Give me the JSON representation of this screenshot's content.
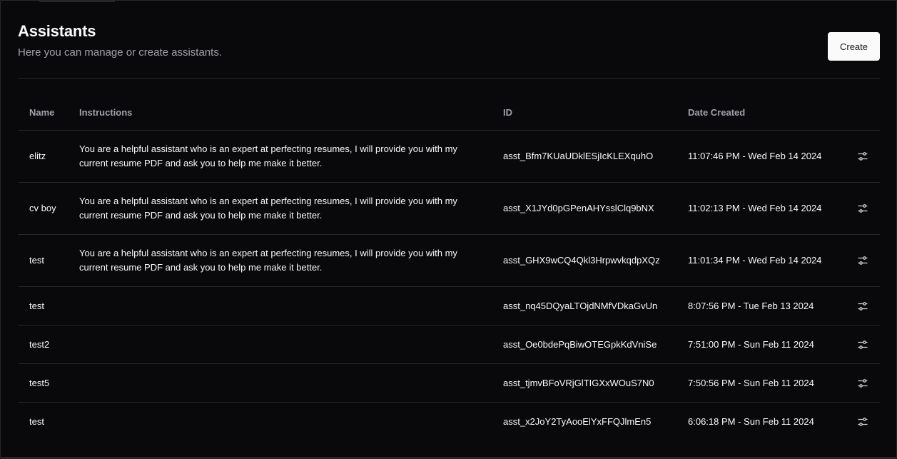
{
  "header": {
    "title": "Assistants",
    "subtitle": "Here you can manage or create assistants.",
    "create_label": "Create"
  },
  "table": {
    "columns": {
      "name": "Name",
      "instructions": "Instructions",
      "id": "ID",
      "date_created": "Date Created"
    },
    "rows": [
      {
        "name": "elitz",
        "instructions": "You are a helpful assistant who is an expert at perfecting resumes, I will provide you with my current resume PDF and ask you to help me make it better.",
        "id": "asst_Bfm7KUaUDklESjIcKLEXquhO",
        "date_created": "11:07:46 PM - Wed Feb 14 2024",
        "action_icon": "settings-sliders-icon"
      },
      {
        "name": "cv boy",
        "instructions": "You are a helpful assistant who is an expert at perfecting resumes, I will provide you with my current resume PDF and ask you to help me make it better.",
        "id": "asst_X1JYd0pGPenAHYsslClq9bNX",
        "date_created": "11:02:13 PM - Wed Feb 14 2024",
        "action_icon": "settings-sliders-icon"
      },
      {
        "name": "test",
        "instructions": "You are a helpful assistant who is an expert at perfecting resumes, I will provide you with my current resume PDF and ask you to help me make it better.",
        "id": "asst_GHX9wCQ4Qkl3HrpwvkqdpXQz",
        "date_created": "11:01:34 PM - Wed Feb 14 2024",
        "action_icon": "settings-sliders-icon"
      },
      {
        "name": "test",
        "instructions": "",
        "id": "asst_nq45DQyaLTOjdNMfVDkaGvUn",
        "date_created": "8:07:56 PM - Tue Feb 13 2024",
        "action_icon": "settings-sliders-icon"
      },
      {
        "name": "test2",
        "instructions": "",
        "id": "asst_Oe0bdePqBiwOTEGpkKdVniSe",
        "date_created": "7:51:00 PM - Sun Feb 11 2024",
        "action_icon": "settings-sliders-icon"
      },
      {
        "name": "test5",
        "instructions": "",
        "id": "asst_tjmvBFoVRjGlTIGXxWOuS7N0",
        "date_created": "7:50:56 PM - Sun Feb 11 2024",
        "action_icon": "settings-sliders-icon"
      },
      {
        "name": "test",
        "instructions": "",
        "id": "asst_x2JoY2TyAooElYxFFQJlmEn5",
        "date_created": "6:06:18 PM - Sun Feb 11 2024",
        "action_icon": "settings-sliders-icon"
      }
    ]
  },
  "colors": {
    "background": "#09090b",
    "border": "#27272a",
    "text": "#fafafa",
    "muted": "#a1a1aa",
    "button_bg": "#fafafa",
    "button_text": "#18181b"
  }
}
